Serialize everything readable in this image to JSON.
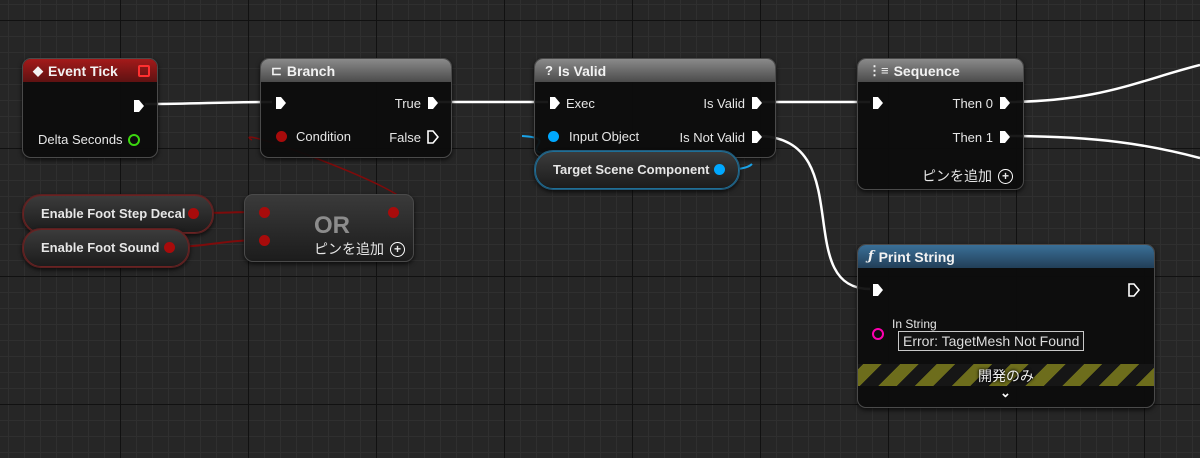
{
  "nodes": {
    "event_tick": {
      "title": "Event Tick",
      "delta_seconds": "Delta Seconds"
    },
    "branch": {
      "title": "Branch",
      "true_label": "True",
      "condition_label": "Condition",
      "false_label": "False"
    },
    "is_valid": {
      "title": "Is Valid",
      "exec_label": "Exec",
      "is_valid_label": "Is Valid",
      "input_object_label": "Input Object",
      "is_not_valid_label": "Is Not Valid"
    },
    "sequence": {
      "title": "Sequence",
      "then0_label": "Then 0",
      "then1_label": "Then 1",
      "add_pin_label": "ピンを追加"
    },
    "or_node": {
      "title": "OR",
      "add_pin_label": "ピンを追加"
    },
    "print_string": {
      "title": "Print String",
      "in_string_label": "In String",
      "in_string_value": "Error: TagetMesh Not Found",
      "dev_only_label": "開発のみ"
    }
  },
  "variables": {
    "enable_foot_step_decal": "Enable Foot Step Decal",
    "enable_foot_sound": "Enable Foot Sound",
    "target_scene_component": "Target Scene Component"
  },
  "icons": {
    "event": "diamond-event-icon",
    "branch": "branch-icon",
    "is_valid": "question-icon",
    "sequence": "sequence-icon",
    "function": "function-icon",
    "add_pin": "plus-circle-icon",
    "expand": "chevron-down-icon"
  },
  "colors": {
    "exec_pin": "#ffffff",
    "bool_pin": "#a80b0b",
    "float_pin": "#3bd60f",
    "object_pin": "#00a8ff",
    "string_pin": "#ff00b0",
    "event_header": "#a41a1a",
    "function_header": "#3a6f97"
  }
}
